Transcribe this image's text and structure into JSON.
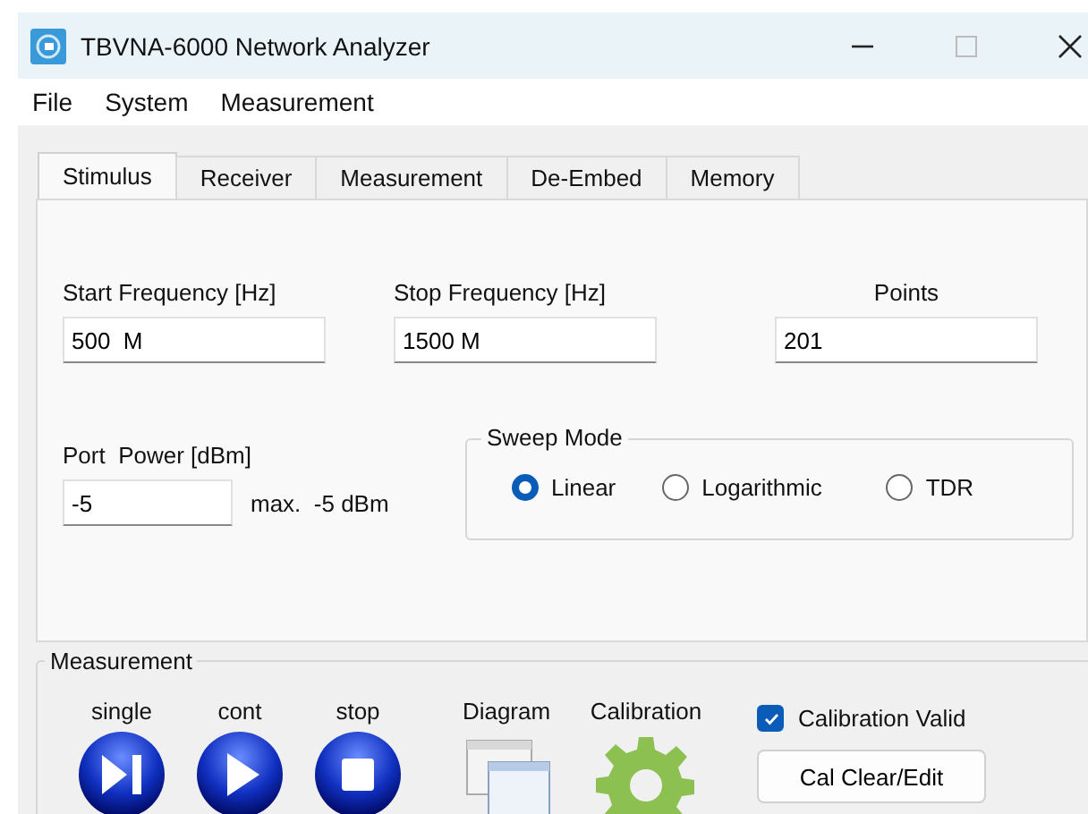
{
  "window": {
    "title": "TBVNA-6000 Network Analyzer"
  },
  "menu": [
    "File",
    "System",
    "Measurement"
  ],
  "tabs": [
    {
      "label": "Stimulus",
      "selected": true
    },
    {
      "label": "Receiver",
      "selected": false
    },
    {
      "label": "Measurement",
      "selected": false
    },
    {
      "label": "De-Embed",
      "selected": false
    },
    {
      "label": "Memory",
      "selected": false
    }
  ],
  "stimulus": {
    "start": {
      "label": "Start Frequency [Hz]",
      "value": "500  M"
    },
    "stop": {
      "label": "Stop Frequency [Hz]",
      "value": "1500 M"
    },
    "points": {
      "label": "Points",
      "value": "201"
    },
    "power": {
      "label": "Port  Power [dBm]",
      "value": "-5",
      "note": "max.  -5 dBm"
    },
    "sweep_mode": {
      "title": "Sweep Mode",
      "options": [
        {
          "label": "Linear",
          "selected": true
        },
        {
          "label": "Logarithmic",
          "selected": false
        },
        {
          "label": "TDR",
          "selected": false
        }
      ]
    }
  },
  "measurement": {
    "title": "Measurement",
    "controls": [
      {
        "label": "single",
        "kind": "single"
      },
      {
        "label": "cont",
        "kind": "cont"
      },
      {
        "label": "stop",
        "kind": "stop"
      },
      {
        "label": "Diagram",
        "kind": "diagram"
      },
      {
        "label": "Calibration",
        "kind": "calibration"
      }
    ],
    "calibration_valid": {
      "label": "Calibration Valid",
      "checked": true
    },
    "cal_button": "Cal Clear/Edit"
  }
}
